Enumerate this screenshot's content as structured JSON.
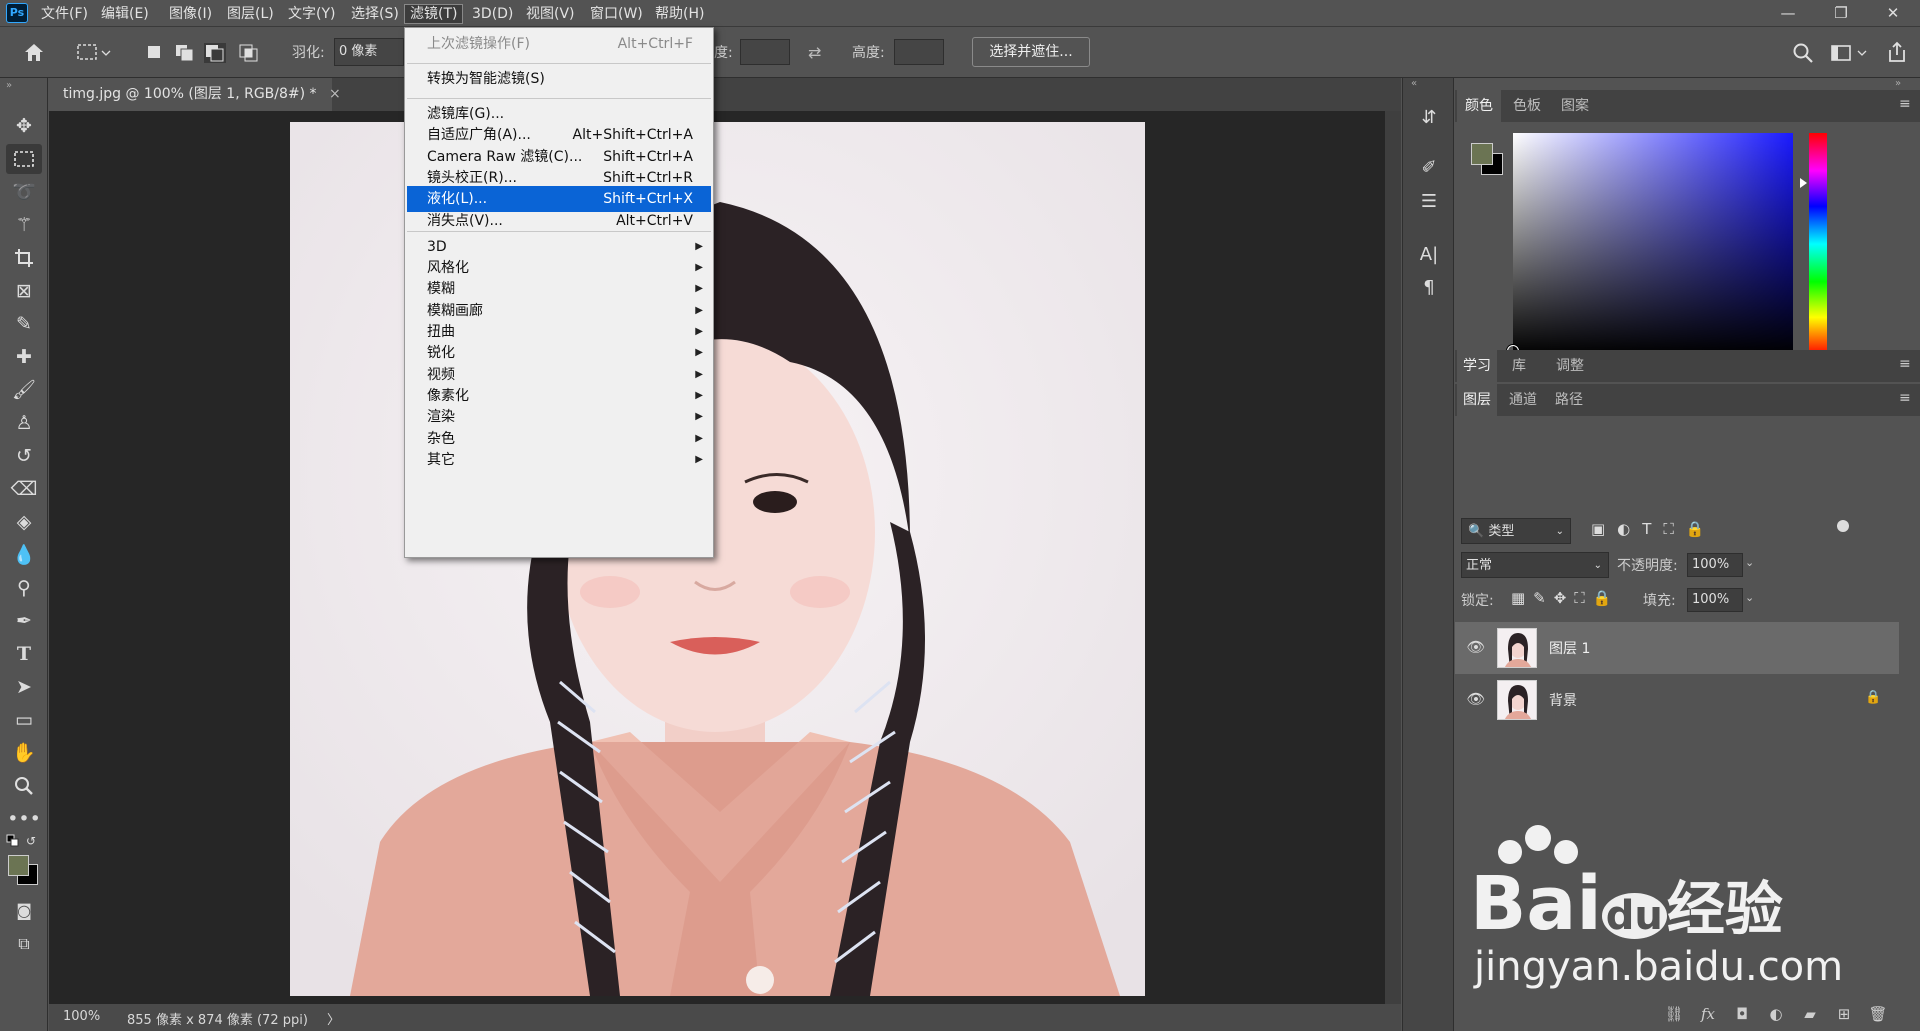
{
  "app": {
    "logo": "Ps"
  },
  "menubar": {
    "items": [
      "文件(F)",
      "编辑(E)",
      "图像(I)",
      "图层(L)",
      "文字(Y)",
      "选择(S)",
      "滤镜(T)",
      "3D(D)",
      "视图(V)",
      "窗口(W)",
      "帮助(H)"
    ],
    "active_index": 6
  },
  "window_controls": {
    "minimize": "—",
    "restore": "❐",
    "close": "✕"
  },
  "options_bar": {
    "feather_label": "羽化:",
    "feather_value": "0 像素",
    "width_label_partial": "度:",
    "height_label": "高度:",
    "select_mask_button": "选择并遮住..."
  },
  "document": {
    "tab_title": "timg.jpg @ 100% (图层 1, RGB/8#) *",
    "close_glyph": "×",
    "zoom": "100%",
    "doc_info": "855 像素 x 874 像素 (72 ppi)",
    "status_arrow": "〉"
  },
  "filter_menu": {
    "items": [
      {
        "label": "上次滤镜操作(F)",
        "shortcut": "Alt+Ctrl+F",
        "disabled": true
      },
      {
        "sep": true
      },
      {
        "label": "转换为智能滤镜(S)",
        "shortcut": ""
      },
      {
        "sep": true
      },
      {
        "label": "滤镜库(G)...",
        "shortcut": ""
      },
      {
        "label": "自适应广角(A)...",
        "shortcut": "Alt+Shift+Ctrl+A"
      },
      {
        "label": "Camera Raw 滤镜(C)...",
        "shortcut": "Shift+Ctrl+A"
      },
      {
        "label": "镜头校正(R)...",
        "shortcut": "Shift+Ctrl+R"
      },
      {
        "label": "液化(L)...",
        "shortcut": "Shift+Ctrl+X",
        "highlighted": true
      },
      {
        "label": "消失点(V)...",
        "shortcut": "Alt+Ctrl+V"
      },
      {
        "sep": true
      },
      {
        "label": "3D",
        "submenu": true
      },
      {
        "label": "风格化",
        "submenu": true
      },
      {
        "label": "模糊",
        "submenu": true
      },
      {
        "label": "模糊画廊",
        "submenu": true
      },
      {
        "label": "扭曲",
        "submenu": true
      },
      {
        "label": "锐化",
        "submenu": true
      },
      {
        "label": "视频",
        "submenu": true
      },
      {
        "label": "像素化",
        "submenu": true
      },
      {
        "label": "渲染",
        "submenu": true
      },
      {
        "label": "杂色",
        "submenu": true
      },
      {
        "label": "其它",
        "submenu": true
      }
    ]
  },
  "color_panel": {
    "tabs": [
      "颜色",
      "色板",
      "图案"
    ],
    "foreground": "#6b7453",
    "background": "#000000",
    "hue_color": "#1a1aff"
  },
  "learn_panel": {
    "tabs": [
      "学习",
      "库",
      "调整"
    ]
  },
  "layers_panel": {
    "tabs": [
      "图层",
      "通道",
      "路径"
    ],
    "filter_kind": "类型",
    "blend_mode": "正常",
    "opacity_label": "不透明度:",
    "opacity_value": "100%",
    "lock_label": "锁定:",
    "fill_label": "填充:",
    "fill_value": "100%",
    "layers": [
      {
        "name": "图层 1",
        "selected": true,
        "locked": false
      },
      {
        "name": "背景",
        "selected": false,
        "locked": true
      }
    ]
  },
  "watermark": {
    "brand": "Bai",
    "brand2": "du",
    "cn": "经验",
    "url": "jingyan.baidu.com"
  }
}
